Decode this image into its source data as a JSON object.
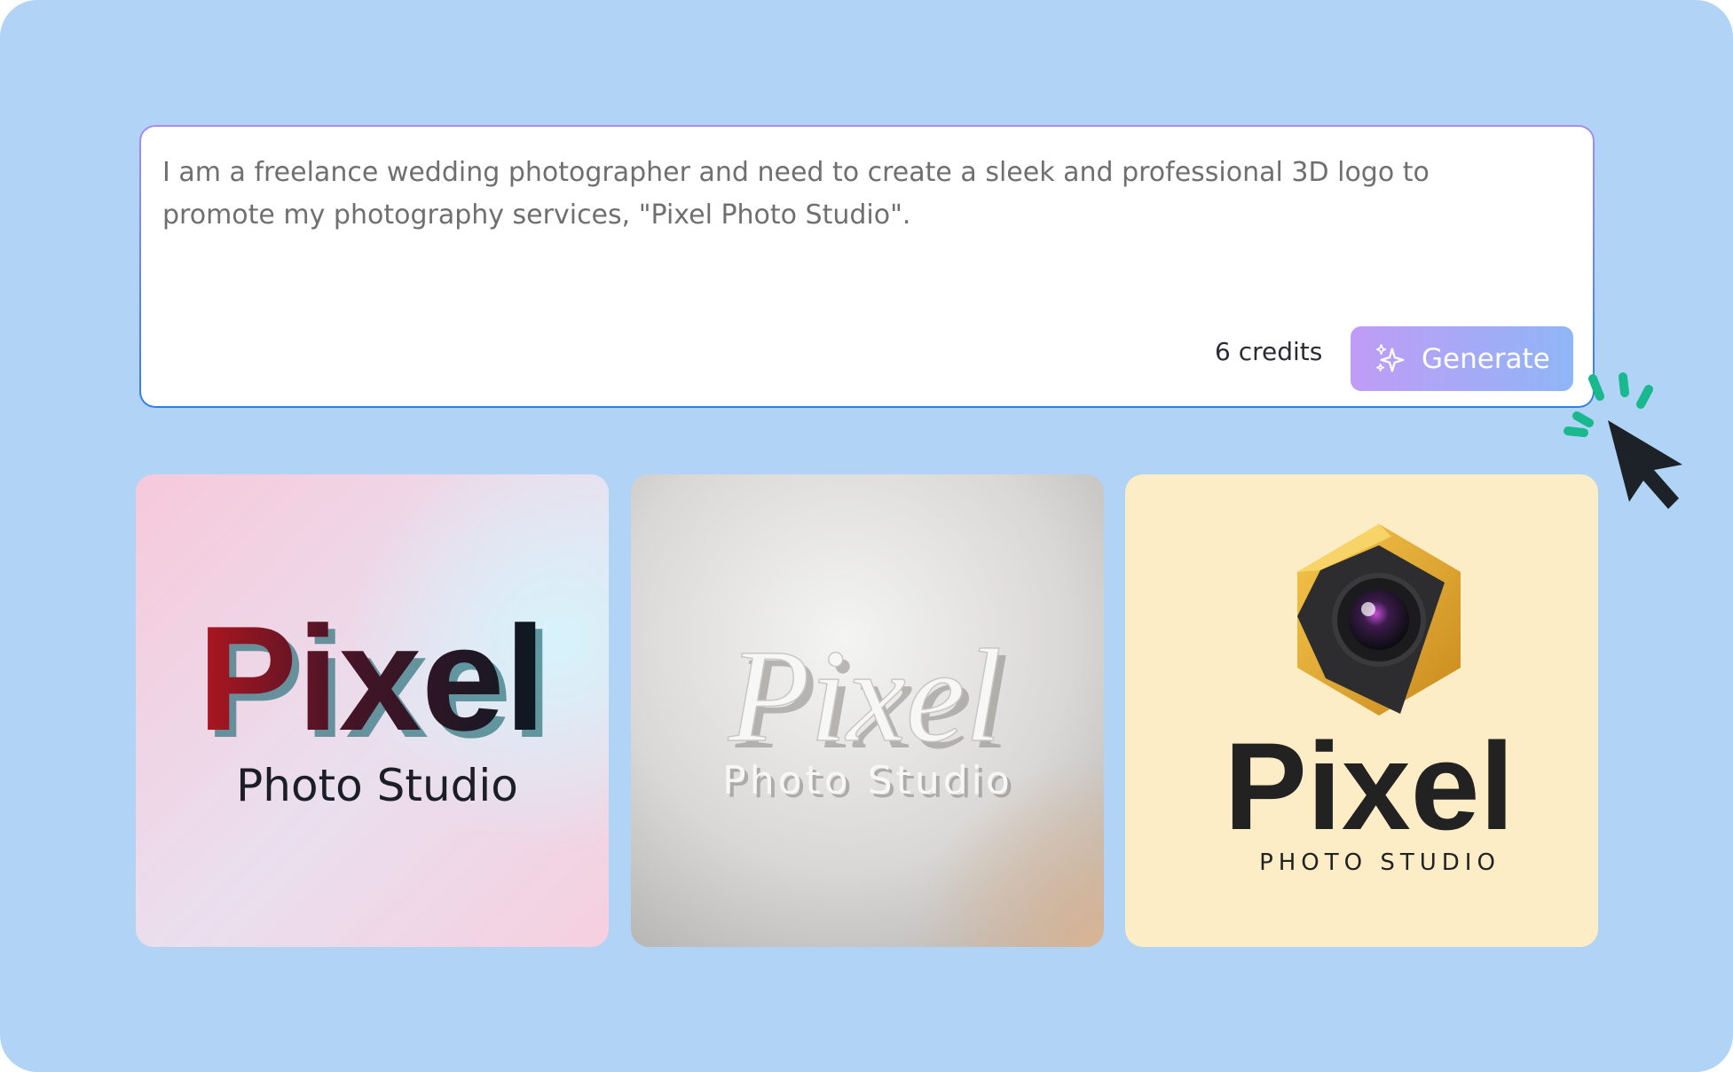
{
  "prompt": {
    "text": "I am a freelance wedding photographer and need to create a sleek and professional 3D logo to promote my photography services, \"Pixel Photo Studio\"."
  },
  "footer": {
    "credits": "6 credits",
    "generate_label": "Generate",
    "generate_icon": "sparkles-icon"
  },
  "results": [
    {
      "title": "Pixel",
      "subtitle": "Photo Studio"
    },
    {
      "title": "Pixel",
      "subtitle": "Photo Studio"
    },
    {
      "title": "Pixel",
      "subtitle": "PHOTO STUDIO"
    }
  ],
  "colors": {
    "background": "#b1d3f6",
    "accent_start": "#c09cf6",
    "accent_end": "#8fb6f6",
    "click_burst": "#19b88f",
    "cursor": "#1c2227"
  }
}
